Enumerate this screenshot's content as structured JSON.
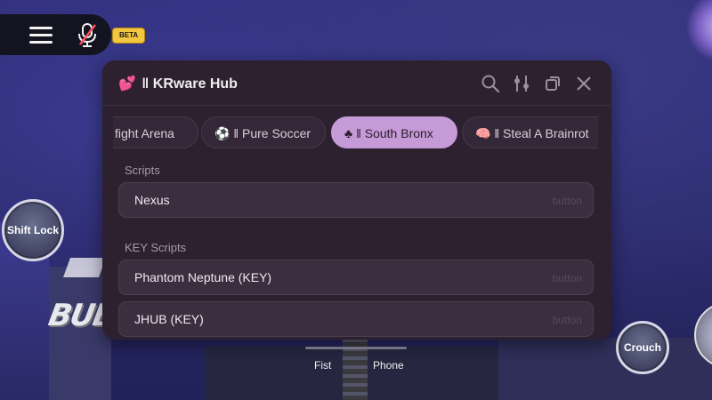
{
  "toolbar": {
    "beta_badge": "BETA"
  },
  "hub": {
    "title": "KRware Hub",
    "title_separator": "‖",
    "tabs": [
      {
        "label": "fight Arena",
        "active": false
      },
      {
        "label": "⚽ ‖ Pure Soccer",
        "active": false
      },
      {
        "label": "♣ ‖ South Bronx",
        "active": true
      },
      {
        "label": "🧠 ‖ Steal A Brainrot",
        "active": false
      }
    ],
    "sections": [
      {
        "title": "Scripts",
        "items": [
          {
            "label": "Nexus",
            "hint": "button"
          }
        ]
      },
      {
        "title": "KEY Scripts",
        "items": [
          {
            "label": "Phantom Neptune (KEY)",
            "hint": "button"
          },
          {
            "label": "JHUB (KEY)",
            "hint": "button"
          }
        ]
      }
    ]
  },
  "game_buttons": {
    "shift_lock": "Shift Lock",
    "crouch": "Crouch"
  },
  "hotbar": {
    "items": [
      "Fist",
      "Phone"
    ]
  },
  "colors": {
    "accent_tab": "#c59ad6",
    "window_bg": "#2d2130",
    "beta_badge": "#f3c640"
  }
}
